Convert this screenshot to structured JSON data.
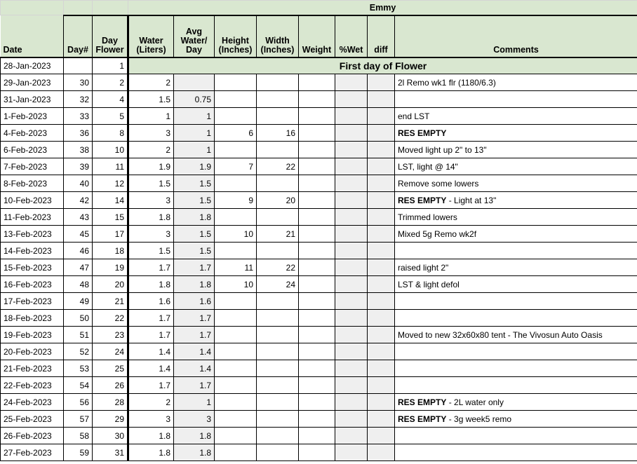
{
  "sheet": {
    "banner_title": "Emmy",
    "flower_banner": "First day of Flower",
    "colors": {
      "header_green": "#d9e7d0",
      "shaded_gray": "#efefef",
      "gridline": "#000000"
    }
  },
  "columns": [
    {
      "key": "date",
      "label": "Date"
    },
    {
      "key": "day",
      "label": "Day#"
    },
    {
      "key": "dayflwr",
      "label": "Day\nFlower"
    },
    {
      "key": "water",
      "label": "Water\n(Liters)"
    },
    {
      "key": "avg",
      "label": "Avg\nWater/\nDay"
    },
    {
      "key": "height",
      "label": "Height\n(Inches)"
    },
    {
      "key": "width",
      "label": "Width\n(Inches)"
    },
    {
      "key": "weight",
      "label": "Weight"
    },
    {
      "key": "wet",
      "label": "%Wet"
    },
    {
      "key": "diff",
      "label": "diff"
    },
    {
      "key": "comments",
      "label": "Comments"
    }
  ],
  "header_labels": {
    "date": "Date",
    "day": "Day#",
    "dayflwr_1": "Day",
    "dayflwr_2": "Flower",
    "water_1": "Water",
    "water_2": "(Liters)",
    "avg_1": "Avg",
    "avg_2": "Water/",
    "avg_3": "Day",
    "height_1": "Height",
    "height_2": "(Inches)",
    "width_1": "Width",
    "width_2": "(Inches)",
    "weight": "Weight",
    "wet": "%Wet",
    "diff": "diff",
    "comments": "Comments"
  },
  "rows": [
    {
      "date": "28-Jan-2023",
      "day": "",
      "dayflwr": "1",
      "water": "",
      "avg": "",
      "height": "",
      "width": "",
      "weight": "",
      "wet": "",
      "diff": "",
      "comment_bold": "",
      "comment_rest": "",
      "flower_banner": true
    },
    {
      "date": "29-Jan-2023",
      "day": "30",
      "dayflwr": "2",
      "water": "2",
      "avg": "",
      "height": "",
      "width": "",
      "weight": "",
      "wet": "",
      "diff": "",
      "comment_bold": "",
      "comment_rest": "2l Remo wk1 flr (1180/6.3)"
    },
    {
      "date": "31-Jan-2023",
      "day": "32",
      "dayflwr": "4",
      "water": "1.5",
      "avg": "0.75",
      "height": "",
      "width": "",
      "weight": "",
      "wet": "",
      "diff": "",
      "comment_bold": "",
      "comment_rest": ""
    },
    {
      "date": "1-Feb-2023",
      "day": "33",
      "dayflwr": "5",
      "water": "1",
      "avg": "1",
      "height": "",
      "width": "",
      "weight": "",
      "wet": "",
      "diff": "",
      "comment_bold": "",
      "comment_rest": "end LST"
    },
    {
      "date": "4-Feb-2023",
      "day": "36",
      "dayflwr": "8",
      "water": "3",
      "avg": "1",
      "height": "6",
      "width": "16",
      "weight": "",
      "wet": "",
      "diff": "",
      "comment_bold": "RES EMPTY",
      "comment_rest": ""
    },
    {
      "date": "6-Feb-2023",
      "day": "38",
      "dayflwr": "10",
      "water": "2",
      "avg": "1",
      "height": "",
      "width": "",
      "weight": "",
      "wet": "",
      "diff": "",
      "comment_bold": "",
      "comment_rest": "Moved light up 2\" to 13\""
    },
    {
      "date": "7-Feb-2023",
      "day": "39",
      "dayflwr": "11",
      "water": "1.9",
      "avg": "1.9",
      "height": "7",
      "width": "22",
      "weight": "",
      "wet": "",
      "diff": "",
      "comment_bold": "",
      "comment_rest": "LST, light @ 14\""
    },
    {
      "date": "8-Feb-2023",
      "day": "40",
      "dayflwr": "12",
      "water": "1.5",
      "avg": "1.5",
      "height": "",
      "width": "",
      "weight": "",
      "wet": "",
      "diff": "",
      "comment_bold": "",
      "comment_rest": "Remove some lowers"
    },
    {
      "date": "10-Feb-2023",
      "day": "42",
      "dayflwr": "14",
      "water": "3",
      "avg": "1.5",
      "height": "9",
      "width": "20",
      "weight": "",
      "wet": "",
      "diff": "",
      "comment_bold": "RES EMPTY",
      "comment_rest": " - Light at 13\""
    },
    {
      "date": "11-Feb-2023",
      "day": "43",
      "dayflwr": "15",
      "water": "1.8",
      "avg": "1.8",
      "height": "",
      "width": "",
      "weight": "",
      "wet": "",
      "diff": "",
      "comment_bold": "",
      "comment_rest": "Trimmed lowers"
    },
    {
      "date": "13-Feb-2023",
      "day": "45",
      "dayflwr": "17",
      "water": "3",
      "avg": "1.5",
      "height": "10",
      "width": "21",
      "weight": "",
      "wet": "",
      "diff": "",
      "comment_bold": "",
      "comment_rest": "Mixed 5g Remo wk2f"
    },
    {
      "date": "14-Feb-2023",
      "day": "46",
      "dayflwr": "18",
      "water": "1.5",
      "avg": "1.5",
      "height": "",
      "width": "",
      "weight": "",
      "wet": "",
      "diff": "",
      "comment_bold": "",
      "comment_rest": ""
    },
    {
      "date": "15-Feb-2023",
      "day": "47",
      "dayflwr": "19",
      "water": "1.7",
      "avg": "1.7",
      "height": "11",
      "width": "22",
      "weight": "",
      "wet": "",
      "diff": "",
      "comment_bold": "",
      "comment_rest": "raised light 2\""
    },
    {
      "date": "16-Feb-2023",
      "day": "48",
      "dayflwr": "20",
      "water": "1.8",
      "avg": "1.8",
      "height": "10",
      "width": "24",
      "weight": "",
      "wet": "",
      "diff": "",
      "comment_bold": "",
      "comment_rest": "LST & light defol"
    },
    {
      "date": "17-Feb-2023",
      "day": "49",
      "dayflwr": "21",
      "water": "1.6",
      "avg": "1.6",
      "height": "",
      "width": "",
      "weight": "",
      "wet": "",
      "diff": "",
      "comment_bold": "",
      "comment_rest": ""
    },
    {
      "date": "18-Feb-2023",
      "day": "50",
      "dayflwr": "22",
      "water": "1.7",
      "avg": "1.7",
      "height": "",
      "width": "",
      "weight": "",
      "wet": "",
      "diff": "",
      "comment_bold": "",
      "comment_rest": ""
    },
    {
      "date": "19-Feb-2023",
      "day": "51",
      "dayflwr": "23",
      "water": "1.7",
      "avg": "1.7",
      "height": "",
      "width": "",
      "weight": "",
      "wet": "",
      "diff": "",
      "comment_bold": "",
      "comment_rest": "Moved to new 32x60x80 tent - The Vivosun Auto Oasis"
    },
    {
      "date": "20-Feb-2023",
      "day": "52",
      "dayflwr": "24",
      "water": "1.4",
      "avg": "1.4",
      "height": "",
      "width": "",
      "weight": "",
      "wet": "",
      "diff": "",
      "comment_bold": "",
      "comment_rest": ""
    },
    {
      "date": "21-Feb-2023",
      "day": "53",
      "dayflwr": "25",
      "water": "1.4",
      "avg": "1.4",
      "height": "",
      "width": "",
      "weight": "",
      "wet": "",
      "diff": "",
      "comment_bold": "",
      "comment_rest": ""
    },
    {
      "date": "22-Feb-2023",
      "day": "54",
      "dayflwr": "26",
      "water": "1.7",
      "avg": "1.7",
      "height": "",
      "width": "",
      "weight": "",
      "wet": "",
      "diff": "",
      "comment_bold": "",
      "comment_rest": ""
    },
    {
      "date": "24-Feb-2023",
      "day": "56",
      "dayflwr": "28",
      "water": "2",
      "avg": "1",
      "height": "",
      "width": "",
      "weight": "",
      "wet": "",
      "diff": "",
      "comment_bold": "RES EMPTY",
      "comment_rest": " - 2L water only"
    },
    {
      "date": "25-Feb-2023",
      "day": "57",
      "dayflwr": "29",
      "water": "3",
      "avg": "3",
      "height": "",
      "width": "",
      "weight": "",
      "wet": "",
      "diff": "",
      "comment_bold": "RES EMPTY",
      "comment_rest": " - 3g week5 remo"
    },
    {
      "date": "26-Feb-2023",
      "day": "58",
      "dayflwr": "30",
      "water": "1.8",
      "avg": "1.8",
      "height": "",
      "width": "",
      "weight": "",
      "wet": "",
      "diff": "",
      "comment_bold": "",
      "comment_rest": ""
    },
    {
      "date": "27-Feb-2023",
      "day": "59",
      "dayflwr": "31",
      "water": "1.8",
      "avg": "1.8",
      "height": "",
      "width": "",
      "weight": "",
      "wet": "",
      "diff": "",
      "comment_bold": "",
      "comment_rest": ""
    }
  ]
}
